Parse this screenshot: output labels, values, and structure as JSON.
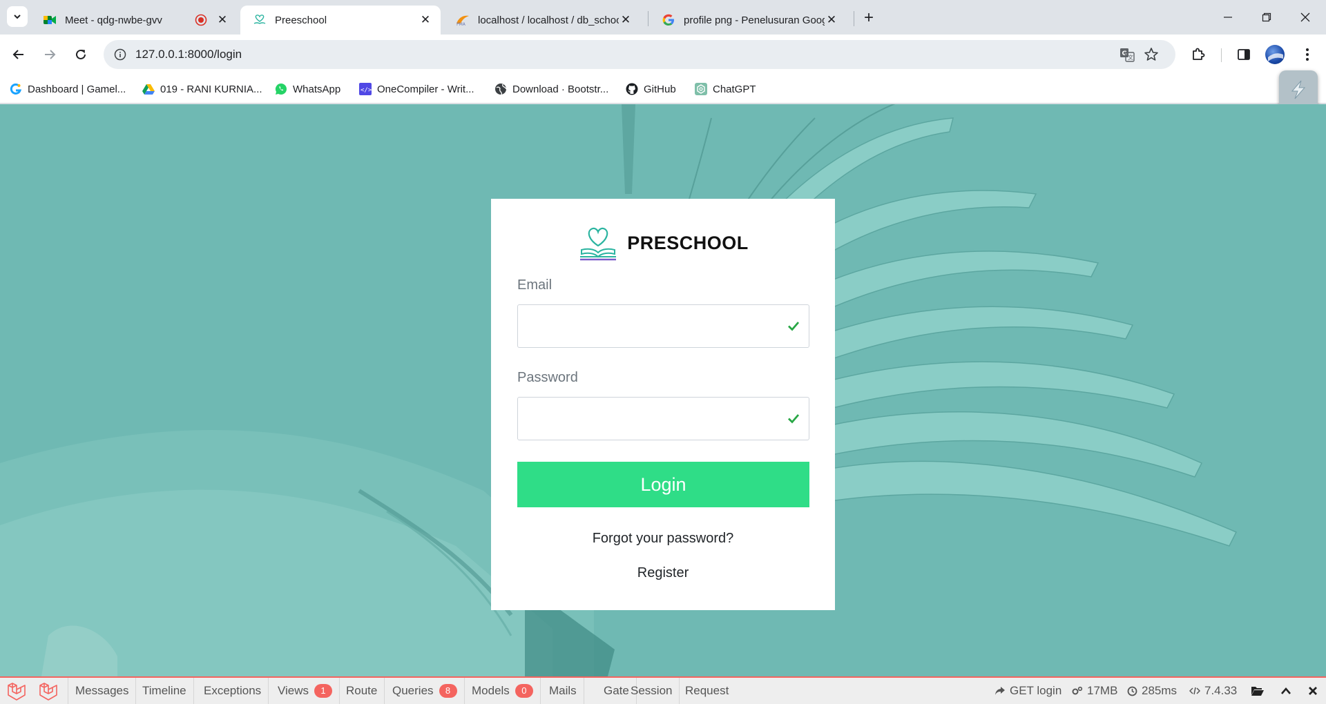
{
  "browser": {
    "tabs": [
      {
        "title": "Meet - qdg-nwbe-gvv",
        "favicon": "google-meet-icon",
        "recording": true
      },
      {
        "title": "Preeschool",
        "favicon": "preschool-heart-icon",
        "active": true
      },
      {
        "title": "localhost / localhost / db_schoo",
        "favicon": "phpmyadmin-icon"
      },
      {
        "title": "profile png - Penelusuran Goog",
        "favicon": "google-icon"
      }
    ],
    "close_glyph": "✕",
    "new_tab_glyph": "+",
    "url": "127.0.0.1:8000/login",
    "bookmarks": [
      {
        "label": "Dashboard | Gamel...",
        "icon": "gamelab-icon"
      },
      {
        "label": "019 - RANI KURNIA...",
        "icon": "google-drive-icon"
      },
      {
        "label": "WhatsApp",
        "icon": "whatsapp-icon"
      },
      {
        "label": "OneCompiler - Writ...",
        "icon": "onecompiler-icon"
      },
      {
        "label": "Download · Bootstr...",
        "icon": "globe-icon"
      },
      {
        "label": "GitHub",
        "icon": "github-icon"
      },
      {
        "label": "ChatGPT",
        "icon": "chatgpt-icon"
      }
    ]
  },
  "login": {
    "brand": "PRESCHOOL",
    "email_label": "Email",
    "email_value": "",
    "password_label": "Password",
    "password_value": "",
    "submit_label": "Login",
    "forgot_label": "Forgot your password?",
    "register_label": "Register"
  },
  "debugbar": {
    "tabs": [
      {
        "label": "Messages"
      },
      {
        "label": "Timeline"
      },
      {
        "label": "Exceptions"
      },
      {
        "label": "Views",
        "badge": "1"
      },
      {
        "label": "Route"
      },
      {
        "label": "Queries",
        "badge": "8"
      },
      {
        "label": "Models",
        "badge": "0"
      },
      {
        "label": "Mails"
      },
      {
        "label": "Gate"
      },
      {
        "label": "Session"
      },
      {
        "label": "Request"
      }
    ],
    "request": "GET login",
    "memory": "17MB",
    "time": "285ms",
    "php_version": "7.4.33"
  },
  "colors": {
    "page_background": "#6fb9b3",
    "login_button": "#2fdd87",
    "debugbar_accent": "#f4645f",
    "check": "#28a745"
  }
}
